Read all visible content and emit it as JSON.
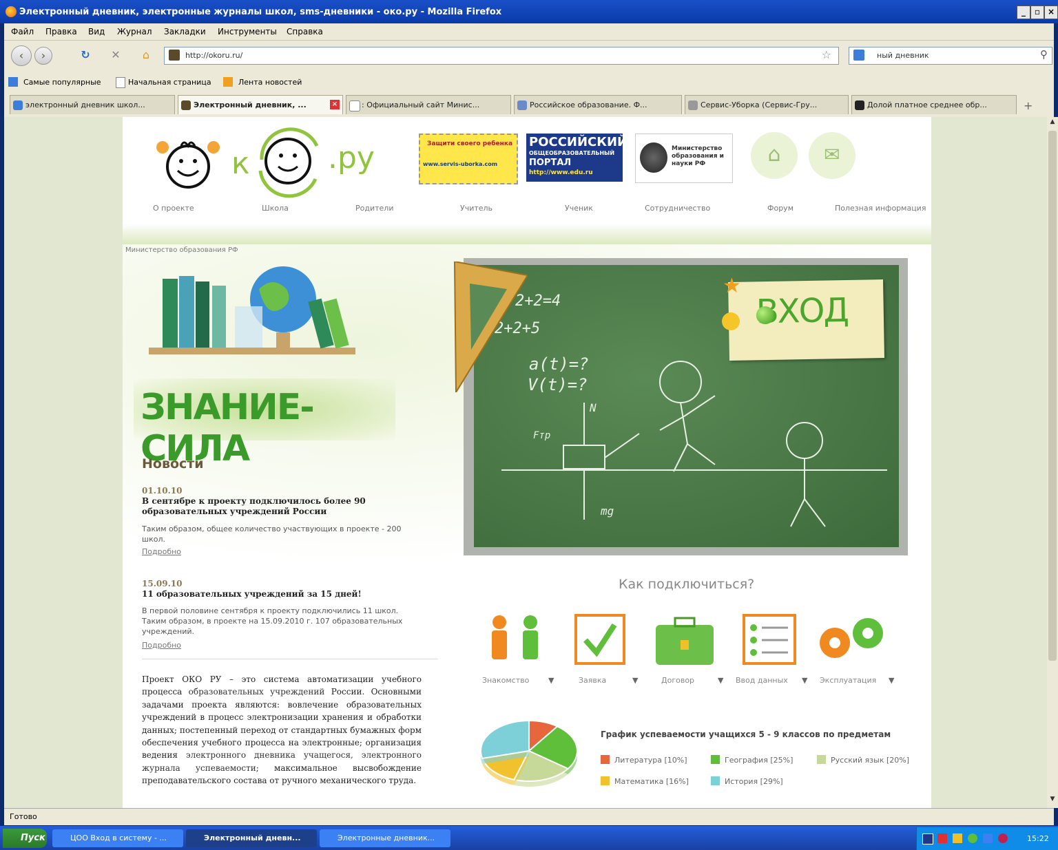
{
  "window": {
    "title": "Электронный дневник, электронные журналы школ, sms-дневники - око.ру - Mozilla Firefox"
  },
  "menu": [
    "Файл",
    "Правка",
    "Вид",
    "Журнал",
    "Закладки",
    "Инструменты",
    "Справка"
  ],
  "address": {
    "url": "http://okoru.ru/"
  },
  "search": {
    "value": "ный дневник"
  },
  "bookmarks": [
    "Самые популярные",
    "Начальная страница",
    "Лента новостей"
  ],
  "tabs": [
    {
      "label": "электронный дневник школ...",
      "active": false
    },
    {
      "label": "Электронный дневник, ...",
      "active": true
    },
    {
      "label": ": Официальный сайт Минис...",
      "active": false
    },
    {
      "label": "Российское образование. Ф...",
      "active": false
    },
    {
      "label": "Сервис-Уборка (Сервис-Гру...",
      "active": false
    },
    {
      "label": "Долой платное среднее обр...",
      "active": false
    }
  ],
  "site": {
    "logo": {
      "k": "к",
      "ru": ".ру"
    },
    "banners": {
      "b1_top": "Защити своего ребенка",
      "b1_bottom": "www.servis-uborka.com",
      "b2_title": "РОССИЙСКИЙ",
      "b2_sub": "ОБЩЕОБРАЗОВАТЕЛЬНЫЙ",
      "b2_portal": "ПОРТАЛ",
      "b2_url": "http://www.edu.ru",
      "b3": "Министерство образования и науки РФ"
    },
    "nav": [
      "О проекте",
      "Школа",
      "Родители",
      "Учитель",
      "Ученик",
      "Сотрудничество",
      "Форум",
      "Полезная информация"
    ],
    "ministry_caption": "Министерство образования РФ",
    "slogan": "ЗНАНИЕ-СИЛА",
    "news_title": "Новости",
    "news": [
      {
        "date": "01.10.10",
        "headline": "В сентябре к проекту подключилось более 90 образовательных учреждений России",
        "body": "Таким образом, общее количество участвующих в проекте - 200 школ.",
        "more": "Подробно"
      },
      {
        "date": "15.09.10",
        "headline": "11 образовательных учреждений за 15 дней!",
        "body": "В первой половине сентября к проекту подключились 11 школ. Таким образом, в проекте на 15.09.2010 г. 107 образовательных учреждений.",
        "more": "Подробно"
      }
    ],
    "about": {
      "p1": "Проект ОКО РУ – это система автоматизации учебного процесса ",
      "link1": "образовательных учреждений",
      "p2": " России. Основными задачами проекта являются: вовлечение образовательных учреждений в процесс электронизации хранения и обработки данных; постепенный переход от стандартных бумажных форм обеспечения учебного процесса на электронные; организация ведения ",
      "link2": "электронного дневника учащегося, электронного журнала успеваемости",
      "p3": "; максимальное высвобождение преподавательского состава от ручного механического труда."
    },
    "board": {
      "eq1": "2+2=4",
      "eq2": "2+2+5",
      "eq3": "a(t)=?",
      "eq4": "V(t)=?",
      "force_n": "N",
      "force_tr": "Fтр",
      "force_mg": "mg"
    },
    "login": "ВХОД",
    "how_title": "Как подключиться?",
    "steps": [
      "Знакомство",
      "Заявка",
      "Договор",
      "Ввод данных",
      "Эксплуатация"
    ],
    "arrow_glyph": "▼",
    "chart_title": "График успеваемости учащихся 5 - 9 классов по предметам",
    "legend_colors": {
      "Литература": "#e8663c",
      "География": "#5fbe3a",
      "Русский язык": "#c7d998",
      "Математика": "#f2c12e",
      "История": "#7dd0d8"
    }
  },
  "chart_data": {
    "type": "pie",
    "title": "График успеваемости учащихся 5 - 9 классов по предметам",
    "categories": [
      "Литература",
      "География",
      "Русский язык",
      "Математика",
      "История"
    ],
    "values": [
      10,
      25,
      20,
      16,
      29
    ],
    "labels": [
      "Литература [10%]",
      "География [25%]",
      "Русский язык [20%]",
      "Математика [16%]",
      "История [29%]"
    ]
  },
  "status": "Готово",
  "taskbar": {
    "start": "Пуск",
    "items": [
      {
        "label": "ЦОО Вход в систему - ...",
        "active": false
      },
      {
        "label": "Электронный дневн...",
        "active": true
      },
      {
        "label": "Электронные дневник...",
        "active": false
      }
    ],
    "clock": "15:22"
  }
}
